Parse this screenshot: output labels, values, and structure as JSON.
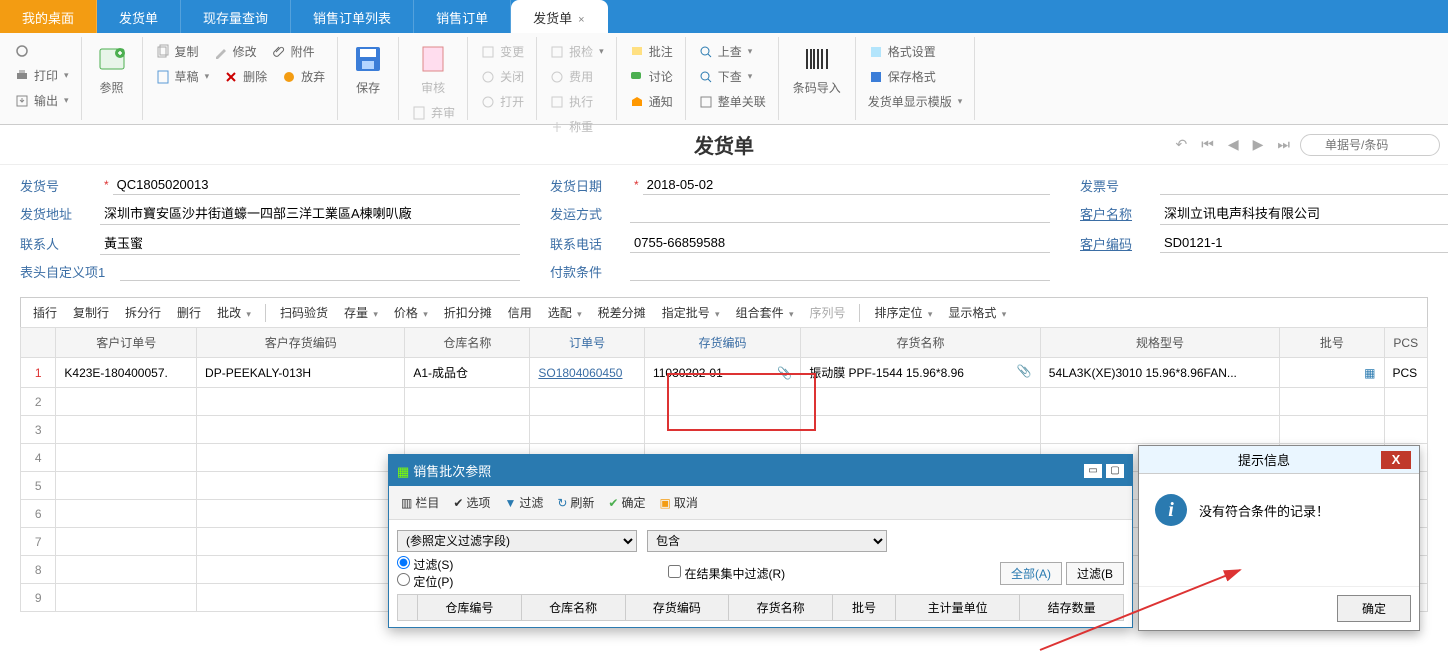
{
  "tabs": [
    {
      "label": "我的桌面",
      "orange": true
    },
    {
      "label": "发货单"
    },
    {
      "label": "现存量查询"
    },
    {
      "label": "销售订单列表"
    },
    {
      "label": "销售订单"
    },
    {
      "label": "发货单",
      "active": true
    }
  ],
  "ribbon": {
    "print": "打印",
    "export": "输出",
    "ref": "参照",
    "copy": "复制",
    "draft": "草稿",
    "modify": "修改",
    "delete": "删除",
    "attach": "附件",
    "discard": "放弃",
    "save": "保存",
    "audit": "审核",
    "abandon": "弃审",
    "change": "变更",
    "close": "关闭",
    "open": "打开",
    "inspect": "报检",
    "fee": "费用",
    "exec": "执行",
    "weigh": "称重",
    "note": "批注",
    "discuss": "讨论",
    "notify": "通知",
    "upcheck": "上查",
    "downcheck": "下查",
    "bill_rel": "整单关联",
    "barcode": "条码导入",
    "format": "格式设置",
    "savefmt": "保存格式",
    "tmpl": "发货单显示模版"
  },
  "titlebar": {
    "title": "发货单",
    "search_ph": "单据号/条码"
  },
  "form": {
    "no_label": "发货号",
    "no": "QC1805020013",
    "date_label": "发货日期",
    "date": "2018-05-02",
    "inv_label": "发票号",
    "inv": "",
    "addr_label": "发货地址",
    "addr": "深圳市寶安區沙井街道蠔一四部三洋工業區A棟喇叭廠",
    "shipmode_label": "发运方式",
    "shipmode": "",
    "custname_label": "客户名称",
    "custname": "深圳立讯电声科技有限公司",
    "contact_label": "联系人",
    "contact": "黃玉蜜",
    "tel_label": "联系电话",
    "tel": "0755-66859588",
    "custcode_label": "客户编码",
    "custcode": "SD0121-1",
    "custom1_label": "表头自定义项1",
    "custom1": "",
    "payterm_label": "付款条件",
    "payterm": ""
  },
  "gridbar": {
    "insert": "插行",
    "copyrow": "复制行",
    "splitrow": "拆分行",
    "delrow": "删行",
    "batchmod": "批改",
    "scanchk": "扫码验货",
    "stock": "存量",
    "price": "价格",
    "discount": "折扣分摊",
    "credit": "信用",
    "match": "选配",
    "tax": "税差分摊",
    "batchno": "指定批号",
    "combo": "组合套件",
    "serial": "序列号",
    "sort": "排序定位",
    "dispfmt": "显示格式"
  },
  "gridcols": {
    "custorder": "客户订单号",
    "custitem": "客户存货编码",
    "wh": "仓库名称",
    "orderno": "订单号",
    "itemcode": "存货编码",
    "itemname": "存货名称",
    "spec": "规格型号",
    "batch": "批号",
    "pcs": "PCS"
  },
  "gridrows": [
    {
      "n": "1",
      "custorder": "K423E-180400057.",
      "custitem": "DP-PEEKALY-013H",
      "wh": "A1-成品仓",
      "orderno": "SO1804060450",
      "itemcode": "11030202-01",
      "itemname": "振动膜 PPF-1544 15.96*8.96",
      "spec": "54LA3K(XE)3010 15.96*8.96FAN...",
      "batch": ""
    },
    {
      "n": "2"
    },
    {
      "n": "3"
    },
    {
      "n": "4"
    },
    {
      "n": "5"
    },
    {
      "n": "6"
    },
    {
      "n": "7"
    },
    {
      "n": "8"
    },
    {
      "n": "9"
    }
  ],
  "dialog": {
    "title": "销售批次参照",
    "tb": {
      "cols": "栏目",
      "opts": "选项",
      "filter": "过滤",
      "refresh": "刷新",
      "ok": "确定",
      "cancel": "取消"
    },
    "field_ph": "(参照定义过滤字段)",
    "op": "包含",
    "radio_filter": "过滤(S)",
    "radio_locate": "定位(P)",
    "chk_infilt": "在结果集中过滤(R)",
    "btn_all": "全部(A)",
    "btn_filter": "过滤(B",
    "cols": {
      "whcode": "仓库编号",
      "whname": "仓库名称",
      "itemcode": "存货编码",
      "itemname": "存货名称",
      "batch": "批号",
      "uom": "主计量单位",
      "qty": "结存数量"
    }
  },
  "msgbox": {
    "title": "提示信息",
    "text": "没有符合条件的记录！",
    "ok": "确定"
  }
}
